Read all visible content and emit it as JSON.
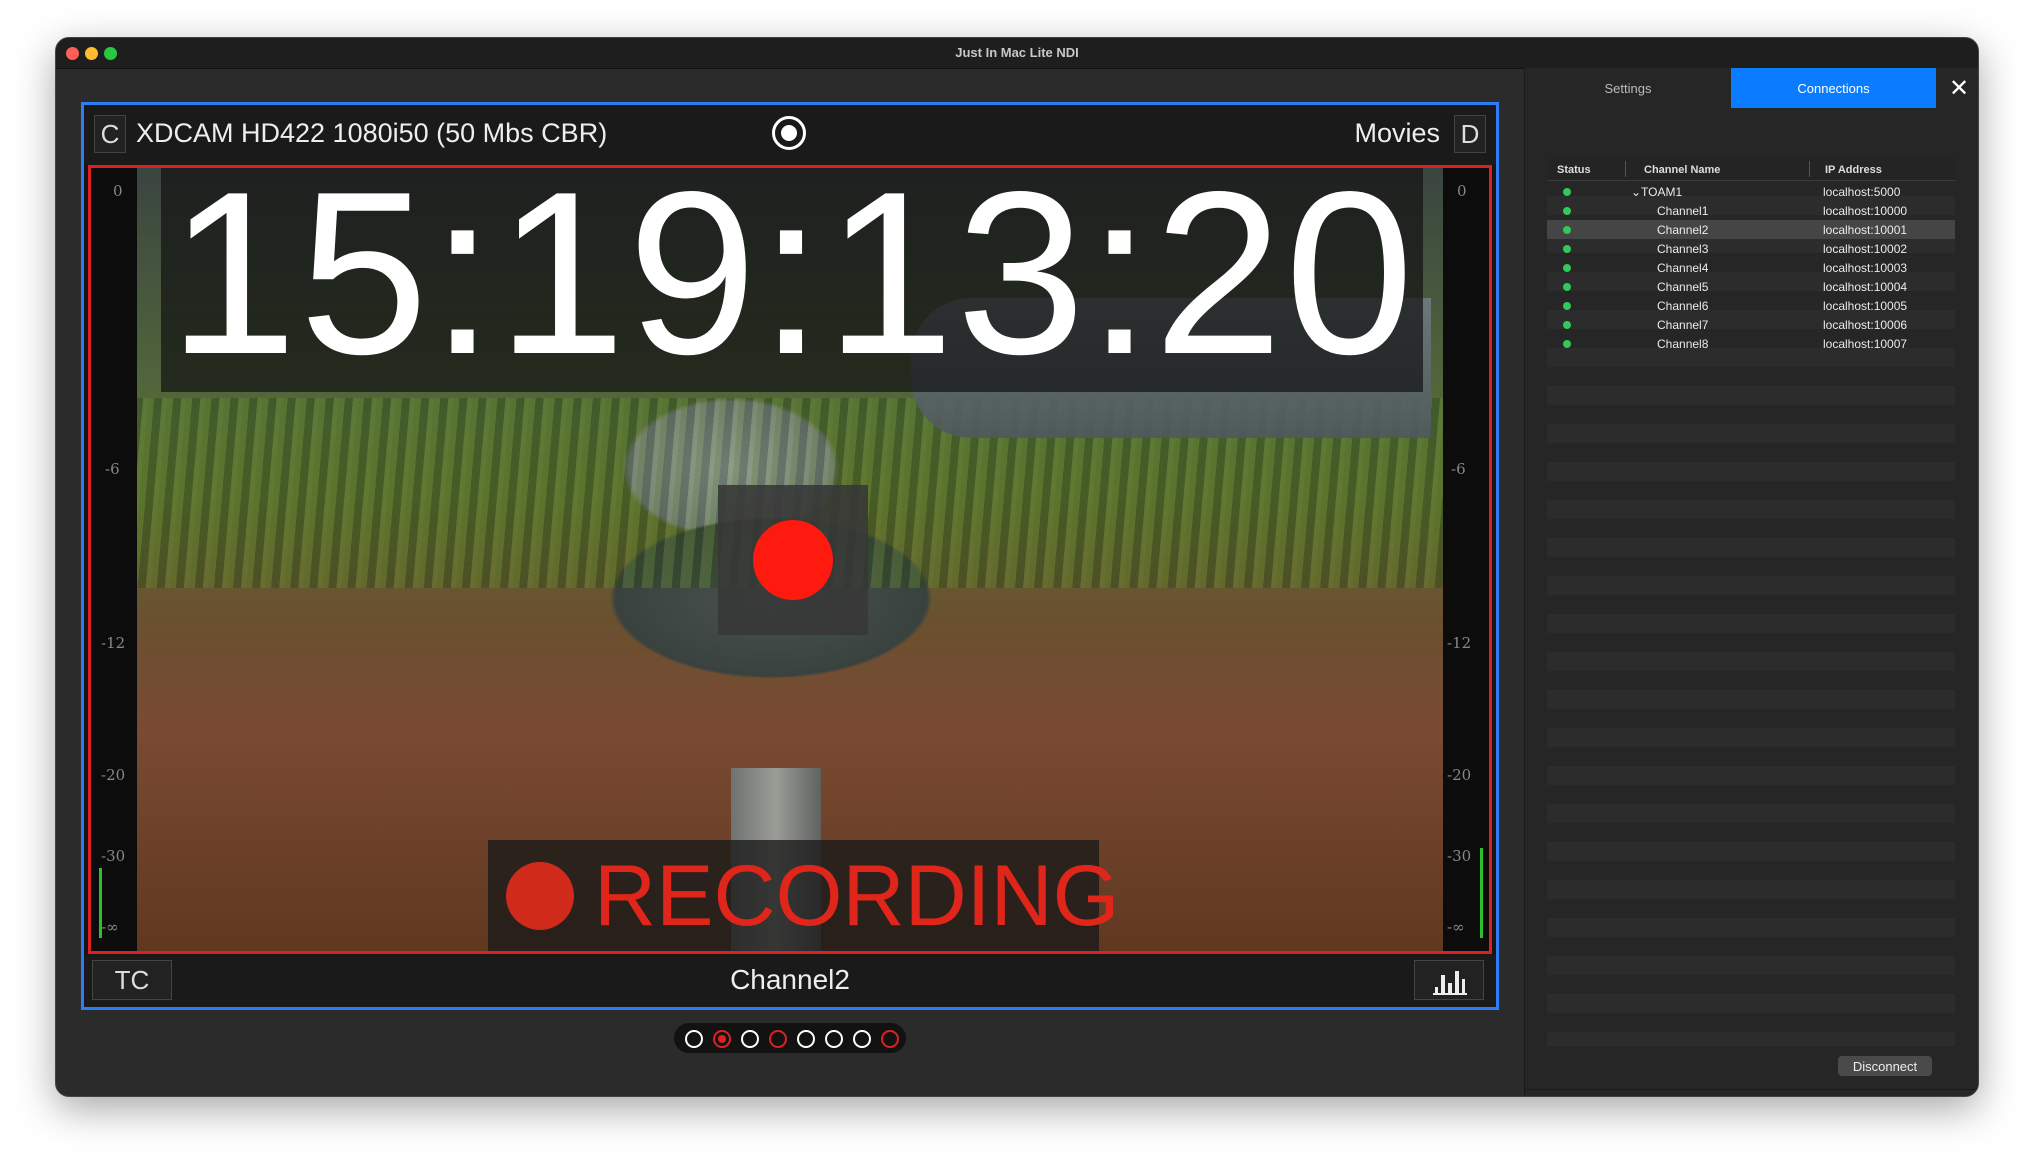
{
  "window": {
    "title": "Just In Mac Lite NDI"
  },
  "player": {
    "left_button": "C",
    "format": "XDCAM HD422 1080i50 (50 Mbs CBR)",
    "target": "Movies",
    "right_button": "D",
    "timecode": "15:19:13:20",
    "recording_label": "RECORDING",
    "tc_button": "TC",
    "channel_name": "Channel2",
    "meter_ticks": [
      "0",
      "-6",
      "-12",
      "-20",
      "-30",
      "-∞"
    ]
  },
  "pager": {
    "dots": [
      {
        "color": "white",
        "filled": false
      },
      {
        "color": "red",
        "filled": true
      },
      {
        "color": "white",
        "filled": false
      },
      {
        "color": "red",
        "filled": false
      },
      {
        "color": "white",
        "filled": false
      },
      {
        "color": "white",
        "filled": false
      },
      {
        "color": "white",
        "filled": false
      },
      {
        "color": "red",
        "filled": false
      }
    ]
  },
  "sidebar": {
    "tabs": [
      {
        "label": "Settings",
        "active": false
      },
      {
        "label": "Connections",
        "active": true
      }
    ],
    "close_icon": "close-icon",
    "table": {
      "headers": [
        "Status",
        "Channel Name",
        "IP Address"
      ],
      "rows": [
        {
          "name": "TOAM1",
          "ip": "localhost:5000",
          "group": true,
          "selected": false
        },
        {
          "name": "Channel1",
          "ip": "localhost:10000",
          "group": false,
          "selected": false
        },
        {
          "name": "Channel2",
          "ip": "localhost:10001",
          "group": false,
          "selected": true
        },
        {
          "name": "Channel3",
          "ip": "localhost:10002",
          "group": false,
          "selected": false
        },
        {
          "name": "Channel4",
          "ip": "localhost:10003",
          "group": false,
          "selected": false
        },
        {
          "name": "Channel5",
          "ip": "localhost:10004",
          "group": false,
          "selected": false
        },
        {
          "name": "Channel6",
          "ip": "localhost:10005",
          "group": false,
          "selected": false
        },
        {
          "name": "Channel7",
          "ip": "localhost:10006",
          "group": false,
          "selected": false
        },
        {
          "name": "Channel8",
          "ip": "localhost:10007",
          "group": false,
          "selected": false
        }
      ]
    },
    "disconnect_label": "Disconnect"
  },
  "colors": {
    "accent": "#0a7cff",
    "record": "#ff1a10",
    "status_ok": "#34c759",
    "frame_selected": "#2e7cf6",
    "frame_recording": "#e02020"
  }
}
